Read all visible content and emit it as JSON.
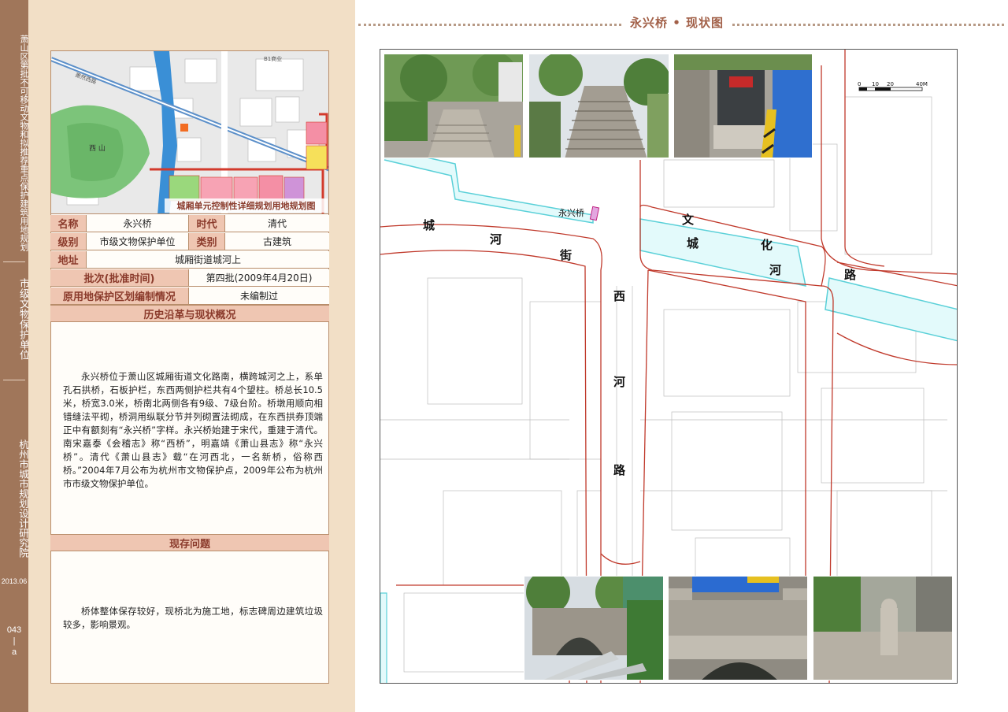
{
  "sidebar": {
    "series_title": "萧山区第批不可移动文物和拟推荐重点保护建筑用地规划",
    "category": "市级文物保护单位",
    "institute": "杭州市城市规划设计研究院",
    "date": "2013.06",
    "page_no": "043",
    "page_suffix": "a"
  },
  "minimap": {
    "caption": "城厢单元控制性详细规划用地规划图",
    "labels": [
      "B1商业",
      "西山",
      "萧然西路"
    ]
  },
  "info_table": {
    "name_label": "名称",
    "name_value": "永兴桥",
    "era_label": "时代",
    "era_value": "清代",
    "level_label": "级别",
    "level_value": "市级文物保护单位",
    "type_label": "类别",
    "type_value": "古建筑",
    "address_label": "地址",
    "address_value": "城厢街道城河上",
    "batch_label": "批次(批准时间)",
    "batch_value": "第四批(2009年4月20日)",
    "zone_label": "原用地保护区划编制情况",
    "zone_value": "未编制过"
  },
  "history": {
    "heading": "历史沿革与现状概况",
    "text": "永兴桥位于萧山区城厢街道文化路南，横跨城河之上，系单孔石拱桥，石板护栏，东西两侧护栏共有4个望柱。桥总长10.5米，桥宽3.0米，桥南北两侧各有9级、7级台阶。桥墩用顺向相错缝法平砌，桥洞用纵联分节并列砌置法砌成，在东西拱券顶端正中有额刻有“永兴桥”字样。永兴桥始建于宋代，重建于清代。南宋嘉泰《会稽志》称“西桥”，明嘉靖《萧山县志》称“永兴桥”。清代《萧山县志》载“在河西北，一名新桥，俗称西桥。”2004年7月公布为杭州市文物保护点，2009年公布为杭州市市级文物保护单位。"
  },
  "issues": {
    "heading": "现存问题",
    "text": "桥体整体保存较好，现桥北为施工地，标志碑周边建筑垃圾较多，影响景观。"
  },
  "right_page": {
    "title": "永兴桥 • 现状图",
    "bridge_label": "永兴桥",
    "roads": {
      "chenghe_street": [
        "城",
        "河",
        "街"
      ],
      "wenhua_road": [
        "文",
        "化",
        "河",
        "路"
      ],
      "xihe_road": [
        "西",
        "河",
        "路"
      ],
      "wenhua_road_right": [
        "城",
        "化"
      ]
    },
    "scale_ticks": [
      "0",
      "10",
      "20",
      "40M"
    ]
  },
  "colors": {
    "sidebar": "#a0765a",
    "beige": "#f2dfc6",
    "label_bg": "#efc6b2",
    "label_text": "#8a3a2b",
    "title_text": "#a26048",
    "red_line": "#c0392b",
    "water": "#5ad0d8"
  }
}
